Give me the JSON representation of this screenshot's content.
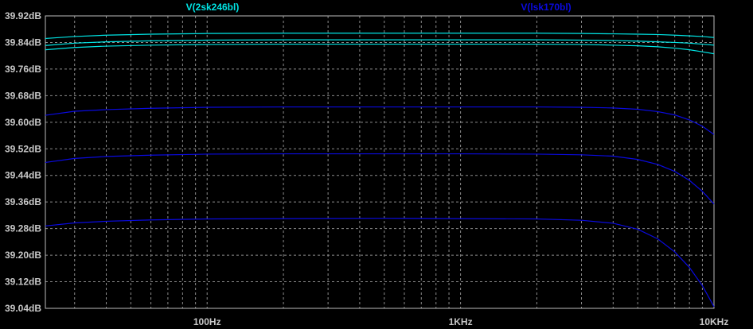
{
  "chart_data": {
    "type": "line",
    "title": "",
    "xlabel": "",
    "ylabel": "",
    "x_scale": "log",
    "x_tick_labels": [
      "100Hz",
      "1KHz",
      "10KHz"
    ],
    "y_tick_labels": [
      "39.92dB",
      "39.84dB",
      "39.76dB",
      "39.68dB",
      "39.60dB",
      "39.52dB",
      "39.44dB",
      "39.36dB",
      "39.28dB",
      "39.20dB",
      "39.12dB",
      "39.04dB"
    ],
    "xlim": [
      23,
      10000
    ],
    "ylim": [
      39.04,
      39.92
    ],
    "grid": true,
    "legend_placement": "top",
    "background": "#000000",
    "grid_color": "#8c8c8c",
    "x": [
      23,
      30,
      40,
      60,
      100,
      200,
      500,
      1000,
      2000,
      3000,
      4000,
      5000,
      6000,
      7000,
      8000,
      9000,
      10000
    ],
    "series": [
      {
        "name": "V(2sk246bl)",
        "color": "#00e5e5",
        "values": [
          39.852,
          39.858,
          39.862,
          39.865,
          39.867,
          39.868,
          39.868,
          39.868,
          39.868,
          39.867,
          39.866,
          39.865,
          39.864,
          39.862,
          39.86,
          39.858,
          39.855
        ]
      },
      {
        "name": "",
        "color": "#00e5e5",
        "values": [
          39.831,
          39.838,
          39.842,
          39.845,
          39.847,
          39.848,
          39.848,
          39.848,
          39.848,
          39.847,
          39.846,
          39.844,
          39.842,
          39.84,
          39.838,
          39.835,
          39.832
        ]
      },
      {
        "name": "",
        "color": "#00e5e5",
        "values": [
          39.818,
          39.825,
          39.829,
          39.832,
          39.834,
          39.835,
          39.835,
          39.835,
          39.835,
          39.834,
          39.832,
          39.83,
          39.827,
          39.823,
          39.818,
          39.812,
          39.806
        ]
      },
      {
        "name": "V(lsk170bl)",
        "color": "#0a0ae0",
        "values": [
          39.621,
          39.633,
          39.638,
          39.642,
          39.645,
          39.646,
          39.646,
          39.646,
          39.646,
          39.645,
          39.643,
          39.639,
          39.632,
          39.622,
          39.607,
          39.588,
          39.563
        ]
      },
      {
        "name": "",
        "color": "#0a0ae0",
        "values": [
          39.479,
          39.491,
          39.497,
          39.501,
          39.504,
          39.505,
          39.505,
          39.505,
          39.504,
          39.502,
          39.498,
          39.488,
          39.473,
          39.452,
          39.425,
          39.392,
          39.354
        ]
      },
      {
        "name": "",
        "color": "#0a0ae0",
        "values": [
          39.288,
          39.297,
          39.302,
          39.306,
          39.309,
          39.31,
          39.311,
          39.31,
          39.309,
          39.305,
          39.296,
          39.278,
          39.249,
          39.21,
          39.163,
          39.108,
          39.045
        ]
      }
    ]
  }
}
